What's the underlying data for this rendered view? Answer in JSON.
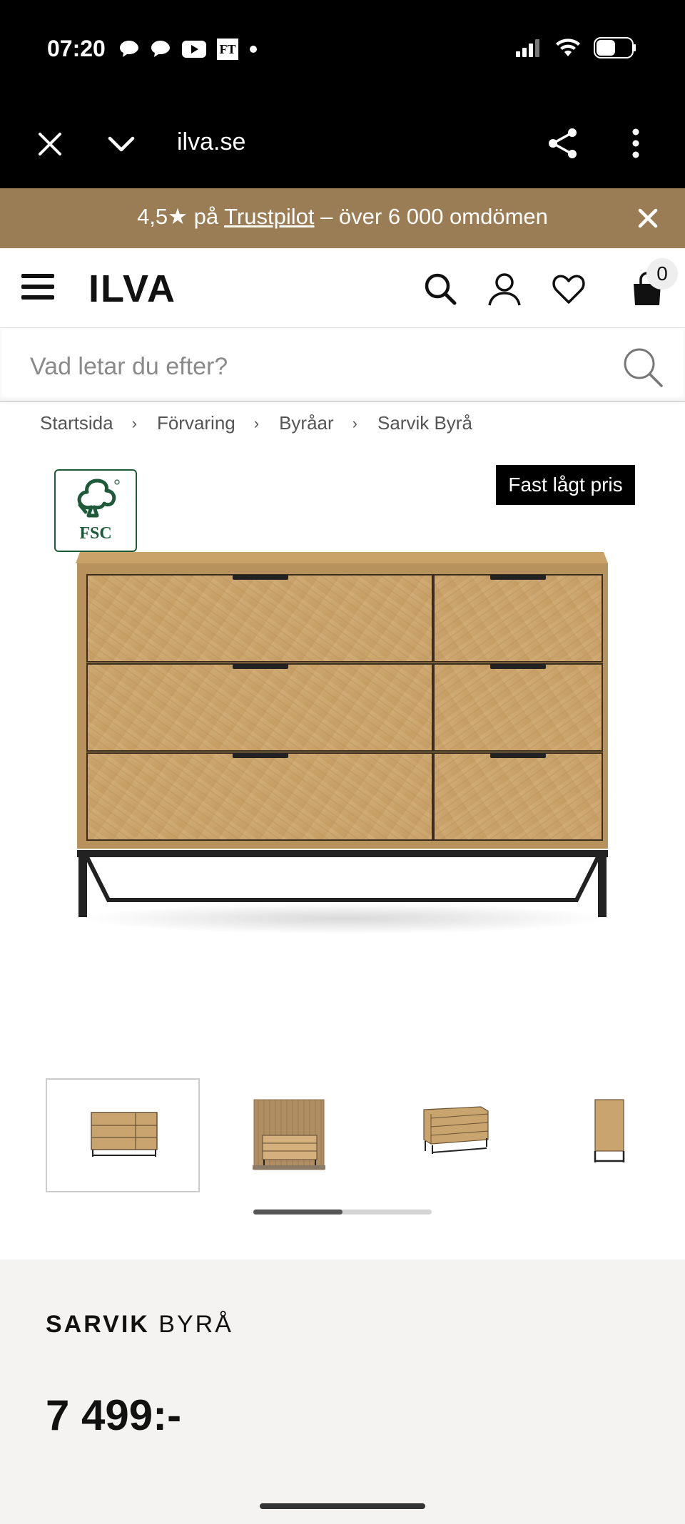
{
  "status_bar": {
    "time": "07:20",
    "ft_label": "FT"
  },
  "browser": {
    "url": "ilva.se"
  },
  "promo": {
    "rating": "4,5★ på ",
    "trustpilot": "Trustpilot",
    "reviews": " – över 6 000 omdömen"
  },
  "header": {
    "logo": "ILVA",
    "cart_count": "0"
  },
  "search": {
    "placeholder": "Vad letar du efter?"
  },
  "breadcrumb": [
    {
      "label": "Startsida"
    },
    {
      "label": "Förvaring"
    },
    {
      "label": "Byråar"
    },
    {
      "label": "Sarvik Byrå"
    }
  ],
  "breadcrumb_separator": "›",
  "badges": {
    "fsc": "FSC",
    "price_tag": "Fast lågt pris"
  },
  "product": {
    "brand": "SARVIK",
    "name": " BYRÅ",
    "price": "7 499:-"
  },
  "gallery": {
    "active_index": 0,
    "thumbnail_count": 4,
    "scroll_position": 0.5
  },
  "colors": {
    "promo_bg": "#9a7c55",
    "info_bg": "#f4f3f1",
    "fsc_green": "#1d5a3a",
    "wood": "#c9a46e"
  }
}
